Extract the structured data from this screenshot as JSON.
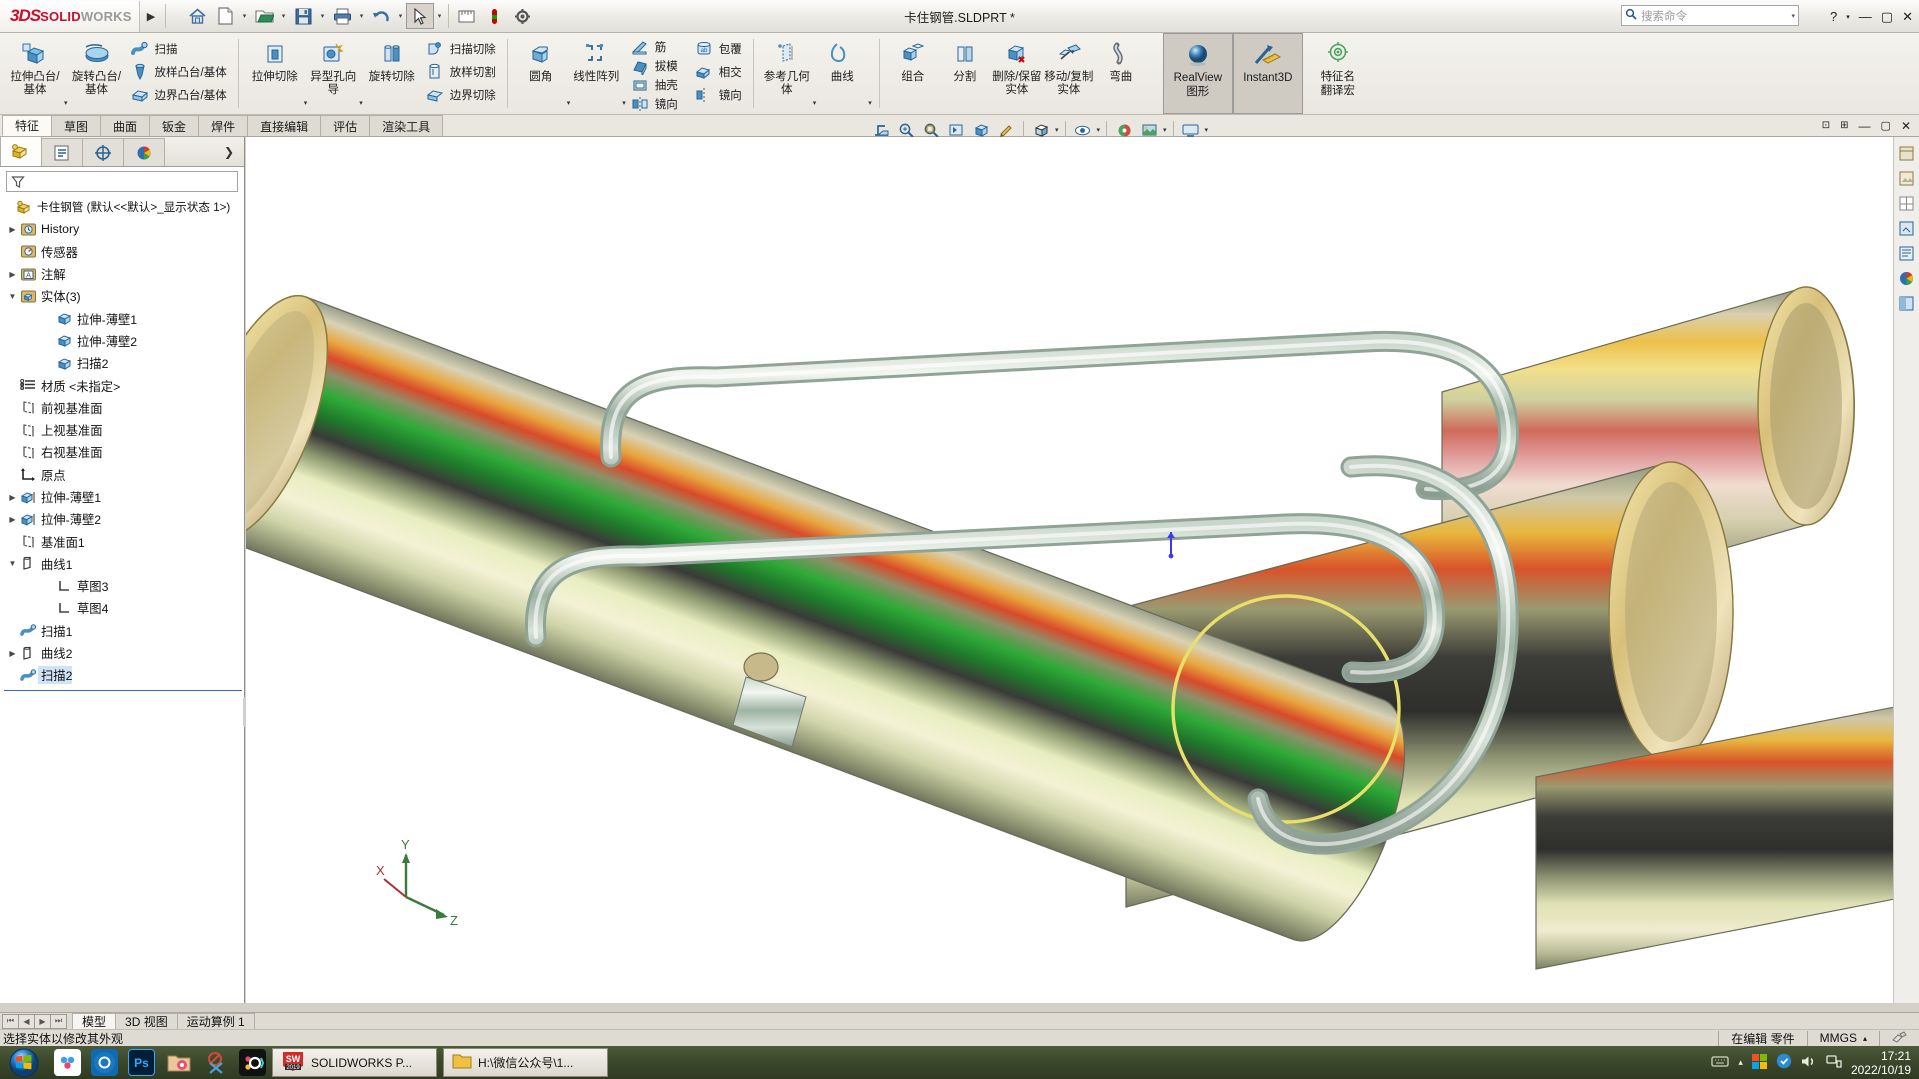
{
  "app": {
    "brand_ds": "3DS",
    "brand_solid": "SOLID",
    "brand_works": "WORKS",
    "title": "卡住钢管.SLDPRT *",
    "expand_arrow": "▶"
  },
  "quickaccess": {
    "items": [
      {
        "name": "home-icon",
        "glyph": "⌂",
        "label": "主页"
      },
      {
        "name": "new-document-icon",
        "glyph": "🗋",
        "label": "新建"
      },
      {
        "name": "open-document-icon",
        "glyph": "📂",
        "label": "打开"
      },
      {
        "name": "save-icon",
        "glyph": "💾",
        "label": "保存"
      },
      {
        "name": "print-icon",
        "glyph": "🖨",
        "label": "打印"
      },
      {
        "name": "undo-icon",
        "glyph": "↺",
        "label": "撤销"
      },
      {
        "name": "select-arrow-icon",
        "glyph": "↖",
        "label": "选择"
      },
      {
        "name": "measure-icon",
        "glyph": "▤",
        "label": "测量"
      },
      {
        "name": "appearance-icon",
        "glyph": "◉",
        "label": "外观"
      },
      {
        "name": "options-icon",
        "glyph": "⚙",
        "label": "选项"
      }
    ],
    "caret": "▾"
  },
  "search": {
    "icon": "搜",
    "placeholder": "搜索命令",
    "caret": "▾"
  },
  "window_buttons": {
    "help": "?",
    "help_caret": "▾",
    "minimize": "—",
    "maximize": "▢",
    "close": "✕"
  },
  "ribbon": {
    "groups": [
      {
        "name": "boss-base-group",
        "big": [
          {
            "label": "拉伸凸台/基体",
            "icon": "extrude-boss-icon",
            "caret": true
          },
          {
            "label": "旋转凸台/基体",
            "icon": "revolve-boss-icon",
            "caret": false
          }
        ],
        "small": [
          {
            "label": "扫描",
            "icon": "sweep-icon"
          },
          {
            "label": "放样凸台/基体",
            "icon": "loft-boss-icon"
          },
          {
            "label": "边界凸台/基体",
            "icon": "boundary-boss-icon"
          }
        ]
      },
      {
        "name": "cut-group",
        "big": [
          {
            "label": "拉伸切除",
            "icon": "extrude-cut-icon",
            "caret": true
          },
          {
            "label": "异型孔向导",
            "icon": "hole-wizard-icon",
            "caret": true
          },
          {
            "label": "旋转切除",
            "icon": "revolve-cut-icon",
            "caret": false
          }
        ],
        "small": [
          {
            "label": "扫描切除",
            "icon": "sweep-cut-icon"
          },
          {
            "label": "放样切割",
            "icon": "loft-cut-icon"
          },
          {
            "label": "边界切除",
            "icon": "boundary-cut-icon"
          }
        ]
      },
      {
        "name": "feature-group",
        "big": [
          {
            "label": "圆角",
            "icon": "fillet-icon",
            "caret": true
          },
          {
            "label": "线性阵列",
            "icon": "linear-pattern-icon",
            "caret": true
          }
        ],
        "small": [
          {
            "label": "筋",
            "icon": "rib-icon"
          },
          {
            "label": "拔模",
            "icon": "draft-icon"
          },
          {
            "label": "抽壳",
            "icon": "shell-icon"
          },
          {
            "label": "镜向",
            "icon": "mirror-icon"
          }
        ]
      },
      {
        "name": "wrap-group",
        "small": [
          {
            "label": "包覆",
            "icon": "wrap-icon"
          },
          {
            "label": "相交",
            "icon": "intersect-icon"
          },
          {
            "label": "镜向",
            "icon": "mirror2-icon"
          }
        ]
      },
      {
        "name": "reference-group",
        "big": [
          {
            "label": "参考几何体",
            "icon": "reference-geometry-icon",
            "caret": true
          },
          {
            "label": "曲线",
            "icon": "curves-icon",
            "caret": true
          }
        ]
      },
      {
        "name": "bodies-group",
        "big": [
          {
            "label": "组合",
            "icon": "combine-icon",
            "caret": false
          },
          {
            "label": "分割",
            "icon": "split-icon",
            "caret": false
          },
          {
            "label": "删除/保留实体",
            "icon": "delete-keep-body-icon",
            "caret": false
          },
          {
            "label": "移动/复制实体",
            "icon": "move-copy-body-icon",
            "caret": false
          },
          {
            "label": "弯曲",
            "icon": "flex-icon",
            "caret": false
          }
        ]
      },
      {
        "name": "display-group",
        "big": [
          {
            "label": "RealView 图形",
            "label1": "RealView",
            "label2": "图形",
            "icon": "realview-icon",
            "active": true
          },
          {
            "label": "Instant3D",
            "label1": "Instant3D",
            "label2": "",
            "icon": "instant3d-icon",
            "active": true
          },
          {
            "label": "特征名翻译宏",
            "label1": "特征名",
            "label2": "翻译宏",
            "icon": "translate-macro-icon",
            "active": false
          }
        ]
      }
    ]
  },
  "command_tabs": {
    "items": [
      "特征",
      "草图",
      "曲面",
      "钣金",
      "焊件",
      "直接编辑",
      "评估",
      "渲染工具"
    ],
    "selected": "特征"
  },
  "view_toolbar": {
    "items": [
      {
        "name": "section-view-icon",
        "glyph": "⊥"
      },
      {
        "name": "zoom-to-fit-icon",
        "glyph": "⌖"
      },
      {
        "name": "zoom-area-icon",
        "glyph": "🔍"
      },
      {
        "name": "previous-view-icon",
        "glyph": "◱"
      },
      {
        "name": "view-orientation-icon",
        "glyph": "⬓"
      },
      {
        "name": "3d-drawing-view-icon",
        "glyph": "✎"
      },
      {
        "name": "display-style-icon",
        "glyph": "◧"
      },
      {
        "name": "hide-show-icon",
        "glyph": "◉"
      },
      {
        "name": "edit-appearance-icon",
        "glyph": "🎨"
      },
      {
        "name": "apply-scene-icon",
        "glyph": "▦"
      },
      {
        "name": "view-settings-icon",
        "glyph": "🖵"
      }
    ]
  },
  "tree_tabs": {
    "items": [
      {
        "name": "feature-manager-tab",
        "glyph": "feature-tree"
      },
      {
        "name": "property-manager-tab",
        "glyph": "property"
      },
      {
        "name": "configuration-manager-tab",
        "glyph": "config"
      },
      {
        "name": "display-manager-tab",
        "glyph": "display"
      }
    ],
    "selected": 0,
    "expand": "❯"
  },
  "filter": {
    "icon": "filter-icon",
    "placeholder": ""
  },
  "tree": {
    "root": "卡住钢管  (默认<<默认>_显示状态 1>)",
    "nodes": [
      {
        "label": "History",
        "icon": "history-icon",
        "expand": "▶",
        "indent": 0
      },
      {
        "label": "传感器",
        "icon": "sensor-icon",
        "expand": "",
        "indent": 0
      },
      {
        "label": "注解",
        "icon": "annotations-icon",
        "expand": "▶",
        "indent": 0
      },
      {
        "label": "实体(3)",
        "icon": "solid-bodies-icon",
        "expand": "▼",
        "indent": 0
      },
      {
        "label": "拉伸-薄壁1",
        "icon": "body-icon",
        "expand": "",
        "indent": 2
      },
      {
        "label": "拉伸-薄壁2",
        "icon": "body-icon",
        "expand": "",
        "indent": 2
      },
      {
        "label": "扫描2",
        "icon": "body-icon",
        "expand": "",
        "indent": 2
      },
      {
        "label": "材质 <未指定>",
        "icon": "material-icon",
        "expand": "",
        "indent": 0
      },
      {
        "label": "前视基准面",
        "icon": "plane-icon",
        "expand": "",
        "indent": 0
      },
      {
        "label": "上视基准面",
        "icon": "plane-icon",
        "expand": "",
        "indent": 0
      },
      {
        "label": "右视基准面",
        "icon": "plane-icon",
        "expand": "",
        "indent": 0
      },
      {
        "label": "原点",
        "icon": "origin-icon",
        "expand": "",
        "indent": 0
      },
      {
        "label": "拉伸-薄壁1",
        "icon": "extrude-feature-icon",
        "expand": "▶",
        "indent": 0
      },
      {
        "label": "拉伸-薄壁2",
        "icon": "extrude-feature-icon",
        "expand": "▶",
        "indent": 0
      },
      {
        "label": "基准面1",
        "icon": "plane-icon",
        "expand": "",
        "indent": 0
      },
      {
        "label": "曲线1",
        "icon": "curve-icon",
        "expand": "▼",
        "indent": 0
      },
      {
        "label": "草图3",
        "icon": "sketch-icon",
        "expand": "",
        "indent": 2
      },
      {
        "label": "草图4",
        "icon": "sketch-icon",
        "expand": "",
        "indent": 2
      },
      {
        "label": "扫描1",
        "icon": "sweep-feature-icon",
        "expand": "",
        "indent": 0
      },
      {
        "label": "曲线2",
        "icon": "curve-icon",
        "expand": "▶",
        "indent": 0
      },
      {
        "label": "扫描2",
        "icon": "sweep-feature-icon",
        "expand": "",
        "indent": 0
      }
    ]
  },
  "viewport_right": {
    "items": [
      {
        "name": "view-palette-icon",
        "glyph": "▣"
      },
      {
        "name": "appearances-icon",
        "glyph": "◉"
      },
      {
        "name": "scenes-icon",
        "glyph": "▦"
      },
      {
        "name": "decals-icon",
        "glyph": "▧"
      },
      {
        "name": "custom-props-icon",
        "glyph": "▤"
      },
      {
        "name": "color-swatch-icon",
        "glyph": "◕"
      },
      {
        "name": "display-pane-icon",
        "glyph": "◨"
      }
    ]
  },
  "triad": {
    "x": "X",
    "y": "Y",
    "z": "Z"
  },
  "bottom_tabs": {
    "nav": [
      "⏮",
      "◀",
      "▶",
      "⏭"
    ],
    "items": [
      "模型",
      "3D 视图",
      "运动算例 1"
    ],
    "selected": "模型"
  },
  "statusbar": {
    "message": "选择实体以修改其外观",
    "edit_state": "在编辑 零件",
    "units": "MMGS",
    "units_caret": "▴",
    "overlay_icon": "customize-icon"
  },
  "taskbar": {
    "start": "start-orb",
    "quicklaunch": [
      {
        "name": "cloud-sync-icon",
        "glyph": "☁",
        "color": "#ffffff"
      },
      {
        "name": "camera-icon",
        "glyph": "◎",
        "color": "#1c6fbb"
      },
      {
        "name": "photoshop-icon",
        "glyph": "Ps",
        "color": "#001e36"
      },
      {
        "name": "folder-media-icon",
        "glyph": "🗂",
        "color": "#d9b38c"
      },
      {
        "name": "snip-tool-icon",
        "glyph": "✂",
        "color": "#e8e0d0"
      },
      {
        "name": "obs-icon",
        "glyph": "◯",
        "color": "#000000"
      }
    ],
    "windows": [
      {
        "name": "solidworks-taskbar-item",
        "label": "SOLIDWORKS P...",
        "badge": "2019",
        "icon": "sw-icon"
      },
      {
        "name": "explorer-taskbar-item",
        "label": "H:\\微信公众号\\1...",
        "badge": "",
        "icon": "folder-icon"
      }
    ],
    "tray": [
      {
        "name": "keyboard-tray-icon",
        "glyph": "⌨"
      },
      {
        "name": "show-hidden-icons",
        "glyph": "▴"
      },
      {
        "name": "language-bar-icon",
        "glyph": "▩"
      },
      {
        "name": "sync-tray-icon",
        "glyph": "⬤"
      },
      {
        "name": "volume-tray-icon",
        "glyph": "🔊"
      },
      {
        "name": "network-tray-icon",
        "glyph": "🖧"
      }
    ],
    "time": "17:21",
    "date": "2022/10/19"
  }
}
